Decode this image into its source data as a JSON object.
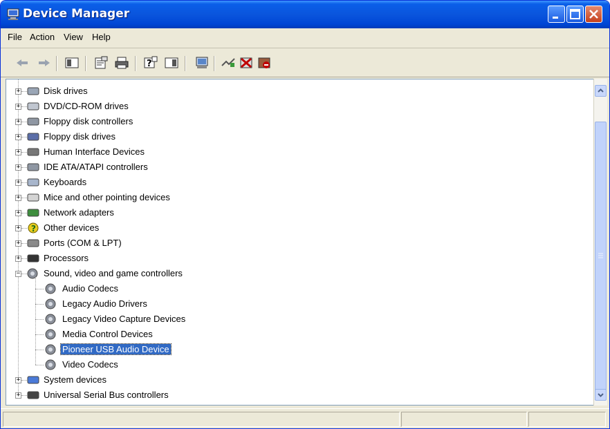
{
  "window": {
    "title": "Device Manager"
  },
  "menu": [
    {
      "label": "File"
    },
    {
      "label": "Action"
    },
    {
      "label": "View"
    },
    {
      "label": "Help"
    }
  ],
  "toolbar": [
    "back-icon",
    "forward-icon",
    "show-hide-tree-icon",
    "properties-icon",
    "print-icon",
    "help-icon",
    "action-pane-icon",
    "scan-hardware-icon",
    "update-driver-icon",
    "uninstall-icon",
    "disable-icon"
  ],
  "tree": {
    "top_categories": [
      {
        "label": "Disk drives",
        "icon": "disk-drive-icon"
      },
      {
        "label": "DVD/CD-ROM drives",
        "icon": "cdrom-icon"
      },
      {
        "label": "Floppy disk controllers",
        "icon": "controller-icon"
      },
      {
        "label": "Floppy disk drives",
        "icon": "floppy-icon"
      },
      {
        "label": "Human Interface Devices",
        "icon": "hid-icon"
      },
      {
        "label": "IDE ATA/ATAPI controllers",
        "icon": "ide-icon"
      },
      {
        "label": "Keyboards",
        "icon": "keyboard-icon"
      },
      {
        "label": "Mice and other pointing devices",
        "icon": "mouse-icon"
      },
      {
        "label": "Network adapters",
        "icon": "network-icon"
      },
      {
        "label": "Other devices",
        "icon": "unknown-device-icon"
      },
      {
        "label": "Ports (COM & LPT)",
        "icon": "port-icon"
      },
      {
        "label": "Processors",
        "icon": "processor-icon"
      },
      {
        "label": "Sound, video and game controllers",
        "icon": "sound-icon",
        "expanded": true
      }
    ],
    "sound_children": [
      {
        "label": "Audio Codecs"
      },
      {
        "label": "Legacy Audio Drivers"
      },
      {
        "label": "Legacy Video Capture Devices"
      },
      {
        "label": "Media Control Devices"
      },
      {
        "label": "Pioneer USB Audio Device",
        "selected": true
      },
      {
        "label": "Video Codecs"
      }
    ],
    "bottom_categories": [
      {
        "label": "System devices",
        "icon": "system-icon"
      },
      {
        "label": "Universal Serial Bus controllers",
        "icon": "usb-icon"
      }
    ]
  },
  "colors": {
    "titlebar": "#0a55dd",
    "selection": "#316ac5",
    "chrome": "#ece9d8"
  }
}
